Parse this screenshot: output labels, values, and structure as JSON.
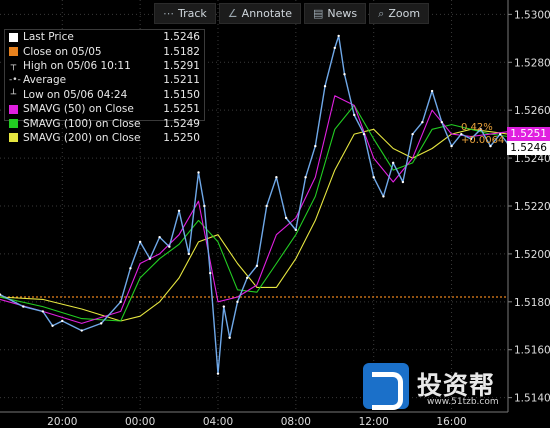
{
  "toolbar": {
    "track": {
      "label": "Track",
      "icon": "track-icon"
    },
    "annotate": {
      "label": "Annotate",
      "icon": "annotate-icon"
    },
    "news": {
      "label": "News",
      "icon": "news-icon"
    },
    "zoom": {
      "label": "Zoom",
      "icon": "zoom-icon"
    }
  },
  "legend": [
    {
      "label": "Last Price",
      "value": "1.5246",
      "marker": "swatch",
      "color": "#ffffff"
    },
    {
      "label": "Close on 05/05",
      "value": "1.5182",
      "marker": "swatch",
      "color": "#e8821e"
    },
    {
      "label": "High on 05/06 10:11",
      "value": "1.5291",
      "marker": "high",
      "color": "#dddddd"
    },
    {
      "label": "Average",
      "value": "1.5211",
      "marker": "avg",
      "color": "#dddddd"
    },
    {
      "label": "Low on 05/06 04:24",
      "value": "1.5150",
      "marker": "low",
      "color": "#dddddd"
    },
    {
      "label": "SMAVG (50) on Close",
      "value": "1.5251",
      "marker": "swatch",
      "color": "#e020e0"
    },
    {
      "label": "SMAVG (100) on Close",
      "value": "1.5249",
      "marker": "swatch",
      "color": "#22cc22"
    },
    {
      "label": "SMAVG (200) on Close",
      "value": "1.5250",
      "marker": "swatch",
      "color": "#e6e640"
    }
  ],
  "change": {
    "pct": "0.42%",
    "abs": "+0.0064"
  },
  "price_tags": {
    "sma50": "1.5251",
    "last": "1.5246"
  },
  "logo": {
    "text": "投资帮",
    "url": "www.51tzb.com"
  },
  "colors": {
    "price": "#6fa8e8",
    "sma50": "#e020e0",
    "sma100": "#22cc22",
    "sma200": "#e6e640",
    "prev_close": "#e8821e",
    "grid": "#3a3a3a",
    "axis_text": "#dddddd"
  },
  "chart_data": {
    "type": "line",
    "x_ticks": [
      "20:00",
      "00:00",
      "04:00",
      "08:00",
      "12:00",
      "16:00"
    ],
    "x_tick_hours": [
      -4,
      0,
      4,
      8,
      12,
      16
    ],
    "x_range_hours": [
      -7.2,
      18.9
    ],
    "y_ticks": [
      "1.5140",
      "1.5160",
      "1.5180",
      "1.5200",
      "1.5220",
      "1.5240",
      "1.5260",
      "1.5280",
      "1.5300"
    ],
    "ylim": [
      1.5134,
      1.5306
    ],
    "reference_lines": [
      {
        "name": "Close on 05/05",
        "value": 1.5182
      }
    ],
    "series": [
      {
        "name": "Last Price",
        "x_hours": [
          -7.2,
          -6,
          -5,
          -4.5,
          -4,
          -3,
          -2,
          -1,
          -0.5,
          0,
          0.5,
          1,
          1.5,
          2,
          2.5,
          3,
          3.3,
          3.6,
          4,
          4.3,
          4.6,
          5,
          5.5,
          6,
          6.5,
          7,
          7.5,
          8,
          8.5,
          9,
          9.5,
          10,
          10.2,
          10.5,
          11,
          11.5,
          12,
          12.5,
          13,
          13.5,
          14,
          14.5,
          15,
          15.5,
          16,
          16.5,
          17,
          17.5,
          18,
          18.5,
          18.9
        ],
        "values": [
          1.5183,
          1.5178,
          1.5176,
          1.517,
          1.5172,
          1.5168,
          1.5171,
          1.518,
          1.5194,
          1.5205,
          1.5198,
          1.5207,
          1.5203,
          1.5218,
          1.52,
          1.5234,
          1.522,
          1.5192,
          1.515,
          1.5178,
          1.5165,
          1.518,
          1.519,
          1.5195,
          1.522,
          1.5232,
          1.5215,
          1.521,
          1.5232,
          1.5245,
          1.527,
          1.5286,
          1.5291,
          1.5275,
          1.5258,
          1.525,
          1.5232,
          1.5224,
          1.5238,
          1.523,
          1.525,
          1.5255,
          1.5268,
          1.5255,
          1.5245,
          1.525,
          1.5248,
          1.5252,
          1.5245,
          1.525,
          1.5246
        ]
      },
      {
        "name": "SMAVG (50) on Close",
        "x_hours": [
          -7.2,
          -5,
          -3,
          -1,
          0,
          1,
          2,
          3,
          4,
          5,
          6,
          7,
          8,
          9,
          10,
          11,
          12,
          13,
          14,
          15,
          16,
          17,
          18,
          18.9
        ],
        "values": [
          1.5181,
          1.5176,
          1.5171,
          1.5176,
          1.5196,
          1.52,
          1.5208,
          1.5222,
          1.518,
          1.5182,
          1.5187,
          1.5208,
          1.5215,
          1.5232,
          1.5266,
          1.5262,
          1.524,
          1.523,
          1.524,
          1.526,
          1.525,
          1.5249,
          1.525,
          1.5251
        ]
      },
      {
        "name": "SMAVG (100) on Close",
        "x_hours": [
          -7.2,
          -5,
          -3,
          -1,
          0,
          1,
          2,
          3,
          4,
          5,
          6,
          7,
          8,
          9,
          10,
          11,
          12,
          13,
          14,
          15,
          16,
          17,
          18,
          18.9
        ],
        "values": [
          1.5182,
          1.5178,
          1.5173,
          1.5172,
          1.519,
          1.5198,
          1.5204,
          1.5214,
          1.5205,
          1.5185,
          1.5184,
          1.5196,
          1.5208,
          1.5224,
          1.5252,
          1.5262,
          1.5248,
          1.5235,
          1.5238,
          1.5252,
          1.5254,
          1.5252,
          1.525,
          1.5249
        ]
      },
      {
        "name": "SMAVG (200) on Close",
        "x_hours": [
          -7.2,
          -5,
          -3,
          -1,
          0,
          1,
          2,
          3,
          4,
          5,
          6,
          7,
          8,
          9,
          10,
          11,
          12,
          13,
          14,
          15,
          16,
          17,
          18,
          18.9
        ],
        "values": [
          1.5182,
          1.5181,
          1.5177,
          1.5172,
          1.5174,
          1.518,
          1.519,
          1.5205,
          1.5208,
          1.5196,
          1.5186,
          1.5186,
          1.5198,
          1.5214,
          1.5235,
          1.525,
          1.5252,
          1.5244,
          1.524,
          1.5244,
          1.525,
          1.5252,
          1.5251,
          1.525
        ]
      }
    ]
  }
}
